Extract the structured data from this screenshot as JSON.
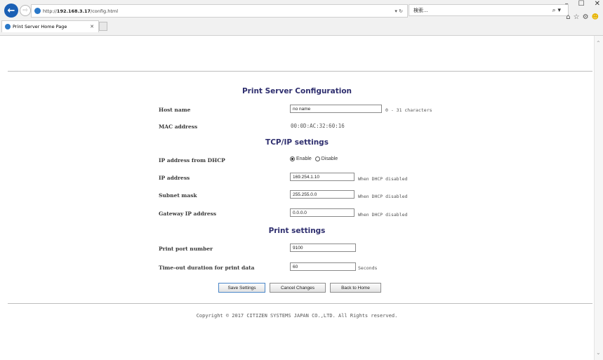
{
  "browser": {
    "back_glyph": "←",
    "forward_glyph": "⇨",
    "url_prefix": "http://",
    "url_host": "192.168.3.17",
    "url_path": "/config.html",
    "addr_tools": "▾ ↻",
    "search_placeholder": "検索...",
    "search_icon_glyph": "⌕ ▾",
    "tab_title": "Print Server Home Page",
    "tab_close": "✕",
    "win_minimize": "–",
    "win_maximize": "☐",
    "win_close": "✕",
    "home_glyph": "⌂",
    "star_glyph": "☆",
    "gear_glyph": "⚙",
    "smiley_glyph": "☻",
    "scroll_up_glyph": "⌃",
    "scroll_down_glyph": "⌄"
  },
  "page": {
    "config_title": "Print Server Configuration",
    "host_name_label": "Host name",
    "host_name_value": "no name",
    "host_name_hint": "0 - 31 characters",
    "mac_label": "MAC address",
    "mac_value": "00:0D:AC:32:60:16",
    "tcpip_title": "TCP/IP settings",
    "dhcp_label": "IP address from DHCP",
    "dhcp_enable": "Enable",
    "dhcp_disable": "Disable",
    "ip_label": "IP address",
    "ip_value": "169.254.1.10",
    "ip_hint": "When DHCP disabled",
    "subnet_label": "Subnet mask",
    "subnet_value": "255.255.0.0",
    "subnet_hint": "When DHCP disabled",
    "gateway_label": "Gateway IP address",
    "gateway_value": "0.0.0.0",
    "gateway_hint": "When DHCP disabled",
    "print_title": "Print settings",
    "port_label": "Print port number",
    "port_value": "9100",
    "timeout_label": "Time-out duration for print data",
    "timeout_value": "60",
    "timeout_hint": "Seconds",
    "save_button": "Save Settings",
    "cancel_button": "Cancel Changes",
    "home_button": "Back to Home",
    "copyright": "Copyright © 2017 CITIZEN SYSTEMS JAPAN CO.,LTD. All Rights reserved."
  }
}
